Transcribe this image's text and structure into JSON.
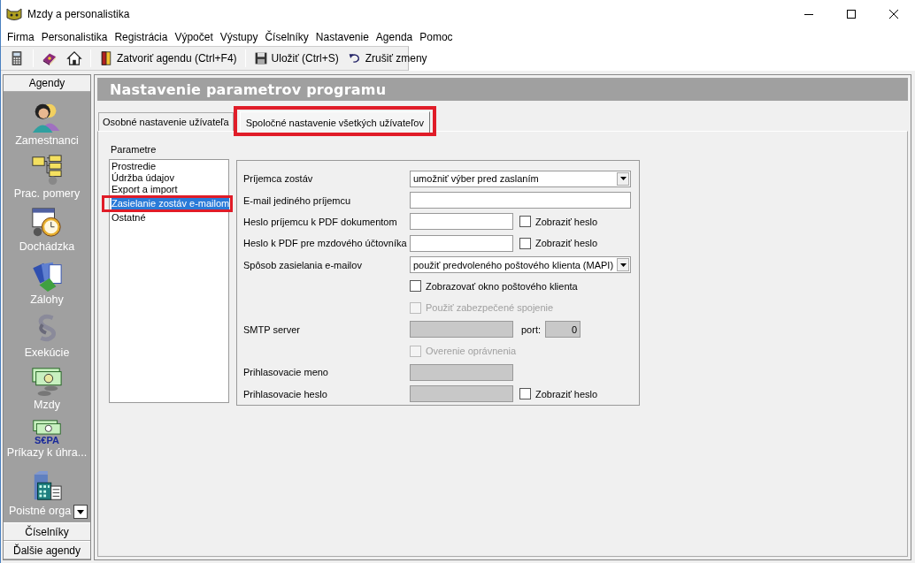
{
  "window": {
    "title": "Mzdy a personalistika"
  },
  "menu": [
    {
      "label": "Firma"
    },
    {
      "label": "Personalistika"
    },
    {
      "label": "Registrácia"
    },
    {
      "label": "Výpočet"
    },
    {
      "label": "Výstupy"
    },
    {
      "label": "Číselníky"
    },
    {
      "label": "Nastavenie"
    },
    {
      "label": "Agenda"
    },
    {
      "label": "Pomoc"
    }
  ],
  "toolbar": [
    {
      "kind": "icon"
    },
    {
      "kind": "separator"
    },
    {
      "kind": "icon"
    },
    {
      "kind": "icon"
    },
    {
      "kind": "separator"
    },
    {
      "kind": "button",
      "label": "Zatvoriť agendu (Ctrl+F4)"
    },
    {
      "kind": "separator"
    },
    {
      "kind": "button",
      "label": "Uložiť (Ctrl+S)"
    },
    {
      "kind": "button",
      "label": "Zrušiť zmeny"
    }
  ],
  "sidebar": {
    "header": "Agendy",
    "items": [
      {
        "label": "Zamestnanci"
      },
      {
        "label": "Prac. pomery"
      },
      {
        "label": "Dochádzka"
      },
      {
        "label": "Zálohy"
      },
      {
        "label": "Exekúcie"
      },
      {
        "label": "Mzdy"
      },
      {
        "label": "Príkazy k úhra...",
        "badge": "S€PA"
      },
      {
        "label": "Poistné orga"
      }
    ],
    "footer": [
      {
        "label": "Číselníky"
      },
      {
        "label": "Ďalšie agendy"
      }
    ]
  },
  "page": {
    "title": "Nastavenie parametrov programu",
    "tabs": [
      {
        "label": "Osobné nastavenie užívateľa",
        "selected": false,
        "highlighted": false
      },
      {
        "label": "Spoločné nastavenie všetkých užívateľov",
        "selected": true,
        "highlighted": true
      }
    ],
    "parameters": {
      "label": "Parametre",
      "items": [
        {
          "label": "Prostredie",
          "selected": false,
          "highlighted": false
        },
        {
          "label": "Údržba údajov",
          "selected": false,
          "highlighted": false
        },
        {
          "label": "Export a import",
          "selected": false,
          "highlighted": false
        },
        {
          "label": "Zasielanie zostáv e-mailom",
          "selected": true,
          "highlighted": true
        },
        {
          "label": "Ostatné",
          "selected": false,
          "highlighted": false
        }
      ]
    },
    "form": [
      {
        "kind": "select",
        "label": "Príjemca zostáv",
        "value": "umožniť výber pred zaslaním"
      },
      {
        "kind": "input-wide",
        "label": "E-mail jediného príjemcu",
        "disabled": false
      },
      {
        "kind": "input",
        "label": "Heslo príjemcu k PDF dokumentom",
        "disabled": false,
        "check": {
          "label": "Zobraziť heslo",
          "checked": false,
          "disabled": false
        }
      },
      {
        "kind": "input",
        "label": "Heslo k PDF pre mzdového účtovníka",
        "disabled": false,
        "check": {
          "label": "Zobraziť heslo",
          "checked": false,
          "disabled": false
        }
      },
      {
        "kind": "select",
        "label": "Spôsob zasielania e-mailov",
        "value": "použiť predvoleného poštového klienta (MAPI)"
      },
      {
        "kind": "checkbox",
        "label": "Zobrazovať okno poštového klienta",
        "checked": false,
        "disabled": false
      },
      {
        "kind": "checkbox",
        "label": "Použiť zabezpečené spojenie",
        "checked": false,
        "disabled": true
      },
      {
        "kind": "input",
        "label": "SMTP server",
        "disabled": true,
        "port": {
          "label": "port:",
          "value": "0"
        }
      },
      {
        "kind": "checkbox",
        "label": "Overenie oprávnenia",
        "checked": false,
        "disabled": true
      },
      {
        "kind": "input",
        "label": "Prihlasovacie meno",
        "disabled": true
      },
      {
        "kind": "input",
        "label": "Prihlasovacie heslo",
        "disabled": true,
        "check": {
          "label": "Zobraziť heslo",
          "checked": false,
          "disabled": false
        }
      }
    ]
  }
}
